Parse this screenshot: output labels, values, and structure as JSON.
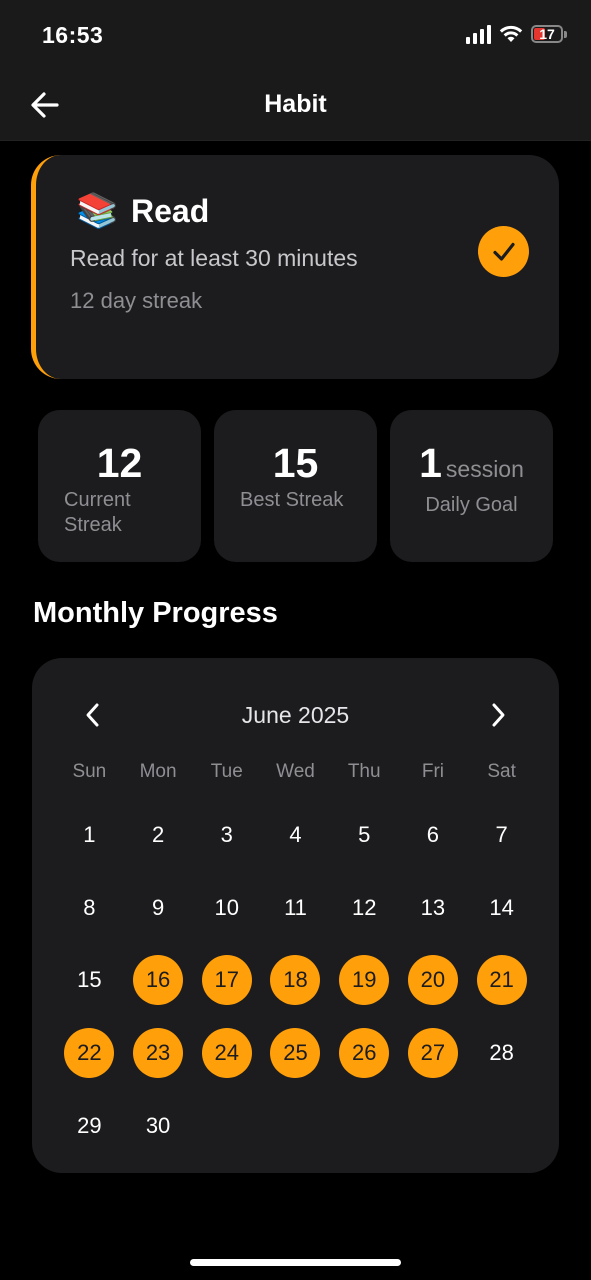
{
  "status": {
    "time": "16:53",
    "battery": "17"
  },
  "nav": {
    "title": "Habit"
  },
  "habit": {
    "emoji": "📚",
    "name": "Read",
    "description": "Read for at least 30 minutes",
    "streak_text": "12 day streak",
    "completed": true,
    "accent_color": "#ff9f0a"
  },
  "stats": {
    "current": {
      "value": "12",
      "label": "Current Streak"
    },
    "best": {
      "value": "15",
      "label": "Best Streak"
    },
    "goal": {
      "value": "1",
      "unit": "session",
      "label": "Daily Goal"
    }
  },
  "section_title": "Monthly Progress",
  "calendar": {
    "month_label": "June 2025",
    "weekdays": [
      "Sun",
      "Mon",
      "Tue",
      "Wed",
      "Thu",
      "Fri",
      "Sat"
    ],
    "leading_blank_days": 0,
    "days": [
      "1",
      "2",
      "3",
      "4",
      "5",
      "6",
      "7",
      "8",
      "9",
      "10",
      "11",
      "12",
      "13",
      "14",
      "15",
      "16",
      "17",
      "18",
      "19",
      "20",
      "21",
      "22",
      "23",
      "24",
      "25",
      "26",
      "27",
      "28",
      "29",
      "30"
    ],
    "completed_days": [
      "16",
      "17",
      "18",
      "19",
      "20",
      "21",
      "22",
      "23",
      "24",
      "25",
      "26",
      "27"
    ]
  },
  "icons": {
    "back": "arrow-left-icon",
    "check": "checkmark-icon",
    "prev": "chevron-left-icon",
    "next": "chevron-right-icon",
    "signal": "cellular-signal-icon",
    "wifi": "wifi-icon",
    "battery": "battery-icon"
  }
}
